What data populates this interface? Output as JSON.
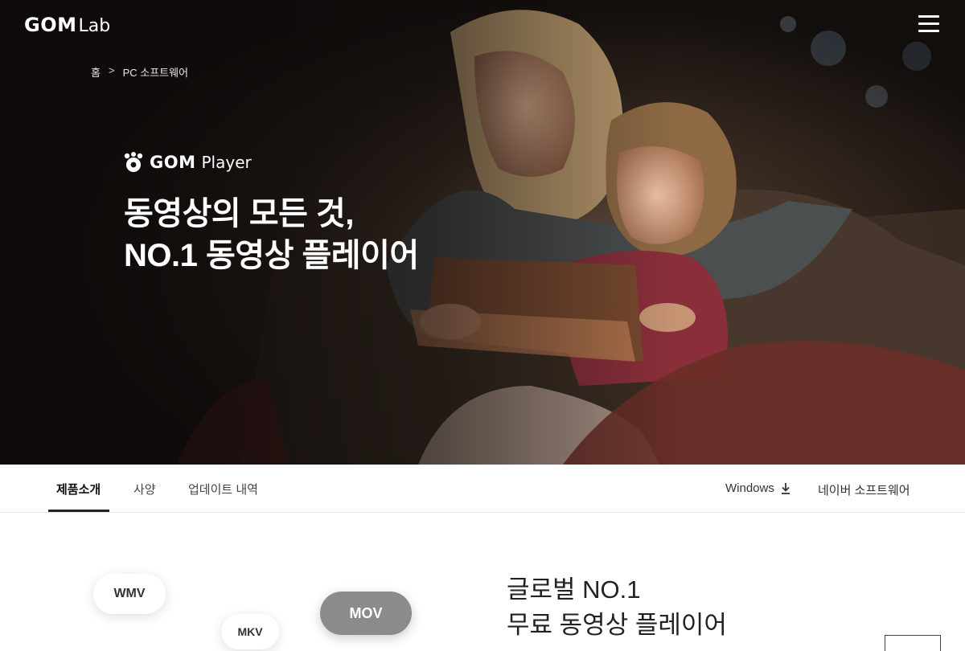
{
  "header": {
    "brand_gom": "GOM",
    "brand_lab": "Lab"
  },
  "breadcrumb": {
    "home": "홈",
    "separator": ">",
    "current": "PC 소프트웨어"
  },
  "hero": {
    "product_name_bold": "GOM",
    "product_name_regular": "Player",
    "headline_line1": "동영상의 모든 것,",
    "headline_line2": "NO.1 동영상 플레이어"
  },
  "tabs": [
    {
      "label": "제품소개",
      "active": true
    },
    {
      "label": "사양",
      "active": false
    },
    {
      "label": "업데이트 내역",
      "active": false
    }
  ],
  "actions": {
    "download_label": "Windows",
    "naver_label": "네이버 소프트웨어"
  },
  "formats": {
    "wmv": "WMV",
    "mkv": "MKV",
    "mov": "MOV"
  },
  "intro": {
    "line1": "글로벌 NO.1",
    "line2": "무료 동영상 플레이어"
  },
  "icons": {
    "menu": "hamburger-icon",
    "download": "download-icon",
    "logo": "gom-paw-icon"
  },
  "colors": {
    "hero_bg": "#14100d",
    "tab_active": "#111111",
    "mov_pill": "#8b8b8b"
  }
}
